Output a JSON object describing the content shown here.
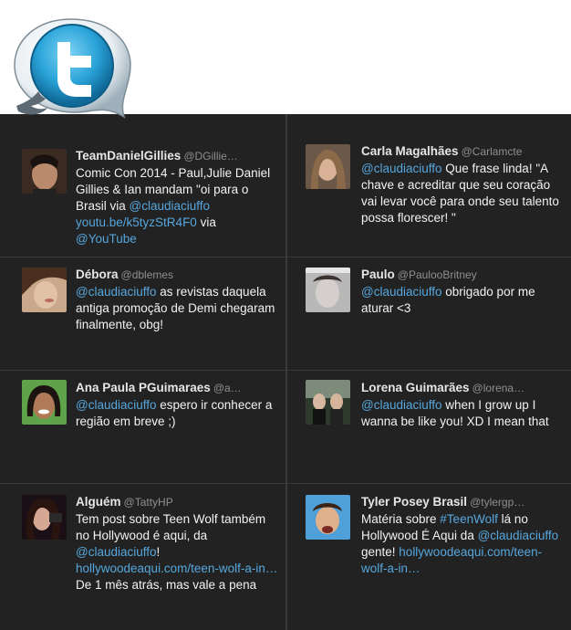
{
  "colors": {
    "background": "#222222",
    "divider": "#3a3a3a",
    "link": "#56a7dd",
    "text": "#f2f2f2",
    "handle": "#8f8f8f",
    "logo_blue": "#2aa3d8"
  },
  "logo": {
    "icon": "twitter-bubble-logo"
  },
  "tweets": [
    {
      "name": "TeamDanielGillies",
      "handle": "@DGillie…",
      "parts": [
        {
          "t": "Comic Con 2014 - Paul,Julie Daniel Gillies & Ian mandam \"oi para o Brasil via "
        },
        {
          "t": "@claudiaciuffo",
          "link": true
        },
        {
          "t": " "
        },
        {
          "t": "youtu.be/k5tyzStR4F0",
          "link": true
        },
        {
          "t": " via "
        },
        {
          "t": "@YouTube",
          "link": true
        }
      ]
    },
    {
      "name": "Carla Magalhães",
      "handle": "@Carlamcte",
      "parts": [
        {
          "t": "@claudiaciuffo",
          "link": true
        },
        {
          "t": " Que frase linda! \"A chave e acreditar que seu coração vai levar você para onde seu talento possa florescer! \""
        }
      ]
    },
    {
      "name": "Débora",
      "handle": "@dblemes",
      "parts": [
        {
          "t": "@claudiaciuffo",
          "link": true
        },
        {
          "t": " as revistas daquela antiga promoção de Demi chegaram finalmente, obg!"
        }
      ]
    },
    {
      "name": "Paulo",
      "handle": "@PaulooBritney",
      "parts": [
        {
          "t": "@claudiaciuffo",
          "link": true
        },
        {
          "t": " obrigado por me aturar <3"
        }
      ]
    },
    {
      "name": "Ana Paula PGuimaraes",
      "handle": "@a…",
      "parts": [
        {
          "t": "@claudiaciuffo",
          "link": true
        },
        {
          "t": " espero ir conhecer a região em breve ;)"
        }
      ]
    },
    {
      "name": "Lorena Guimarães",
      "handle": "@lorena…",
      "parts": [
        {
          "t": "@claudiaciuffo",
          "link": true
        },
        {
          "t": " when I grow up I wanna be like you! XD I mean that"
        }
      ]
    },
    {
      "name": "Alguém",
      "handle": "@TattyHP",
      "parts": [
        {
          "t": "Tem post sobre Teen Wolf também no Hollywood é aqui, da "
        },
        {
          "t": "@claudiaciuffo",
          "link": true
        },
        {
          "t": "! "
        },
        {
          "t": "hollywoodeaqui.com/teen-wolf-a-in…",
          "link": true
        },
        {
          "t": " De 1 mês atrás, mas vale a pena"
        }
      ]
    },
    {
      "name": "Tyler Posey Brasil",
      "handle": "@tylergp…",
      "parts": [
        {
          "t": "Matéria sobre "
        },
        {
          "t": "#TeenWolf",
          "link": true
        },
        {
          "t": " lá no Hollywood É Aqui da "
        },
        {
          "t": "@claudiaciuffo",
          "link": true
        },
        {
          "t": " gente! "
        },
        {
          "t": "hollywoodeaqui.com/teen-wolf-a-in…",
          "link": true
        }
      ]
    }
  ]
}
